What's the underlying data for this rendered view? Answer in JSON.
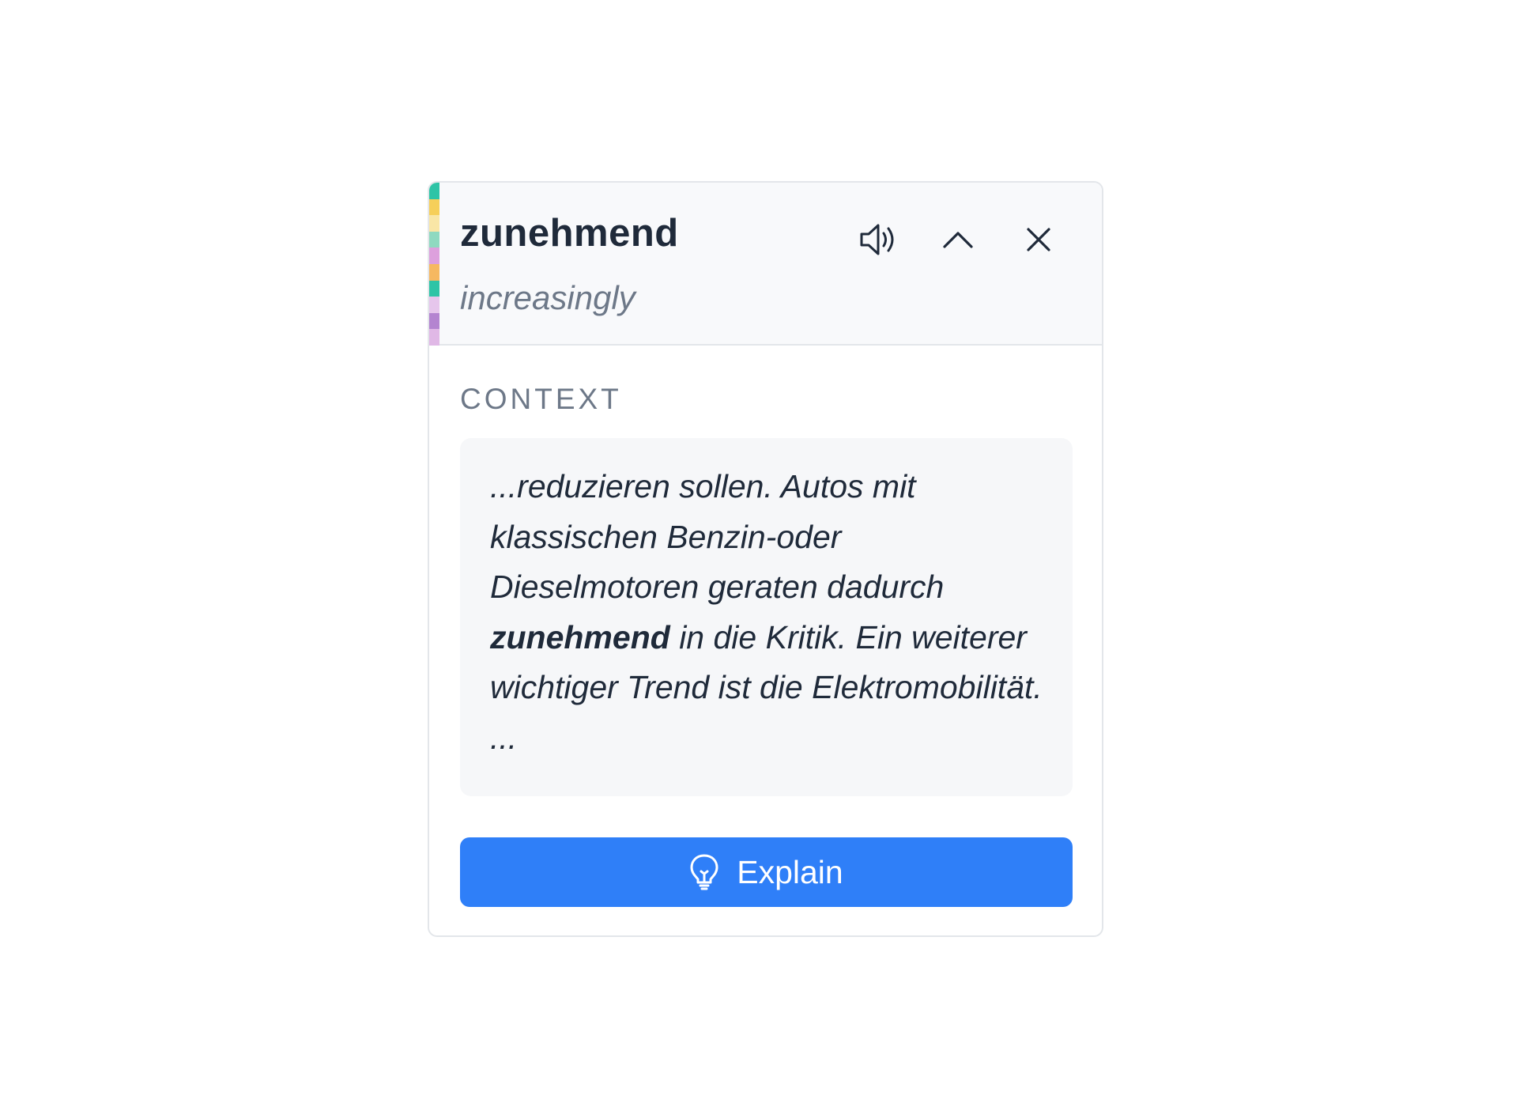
{
  "popup": {
    "word": "zunehmend",
    "translation": "increasingly",
    "icons": {
      "speaker": "speaker-icon",
      "collapse": "chevron-up-icon",
      "close": "close-icon",
      "explain": "lightbulb-icon"
    },
    "stripe_colors": [
      "#2ec4a6",
      "#f6cf5a",
      "#f9e6a6",
      "#8fd9c0",
      "#dda0dd",
      "#f6b860",
      "#2ec4a6",
      "#e6c6ec",
      "#b484d0",
      "#e0b8e6"
    ]
  },
  "context": {
    "label": "CONTEXT",
    "before": "...reduzieren sollen. Autos mit klassischen Benzin-oder Dieselmotoren geraten dadurch ",
    "highlight": "zunehmend",
    "after": " in die Kritik. Ein weiterer wichtiger Trend ist die Elektromobilität. ..."
  },
  "explain_button": {
    "label": "Explain",
    "color": "#2f7ff8"
  }
}
